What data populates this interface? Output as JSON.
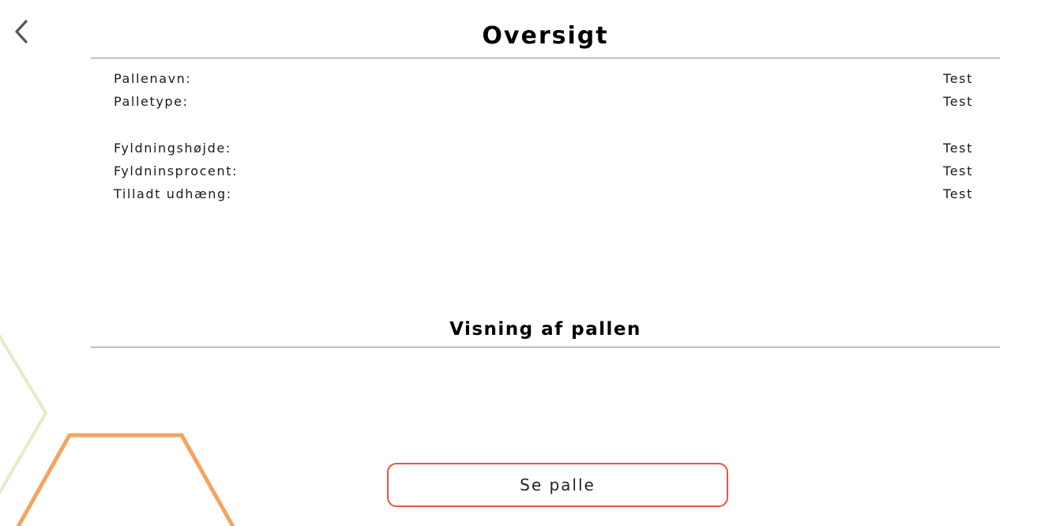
{
  "header": {
    "back_icon": "chevron-left-icon",
    "title": "Oversigt"
  },
  "overview": {
    "rows": [
      {
        "label": "Pallenavn:",
        "value": "Test"
      },
      {
        "label": "Palletype:",
        "value": "Test"
      },
      {
        "label": "Fyldningshøjde:",
        "value": "Test"
      },
      {
        "label": "Fyldninsprocent:",
        "value": "Test"
      },
      {
        "label": "Tilladt udhæng:",
        "value": "Test"
      }
    ]
  },
  "view": {
    "title": "Visning af pallen",
    "button_label": "Se palle"
  },
  "colors": {
    "accent_button_border": "#e8553f",
    "hexagon_orange": "#f39a4c",
    "hexagon_pale": "#e8e4c4",
    "divider": "#8a8a8a"
  }
}
